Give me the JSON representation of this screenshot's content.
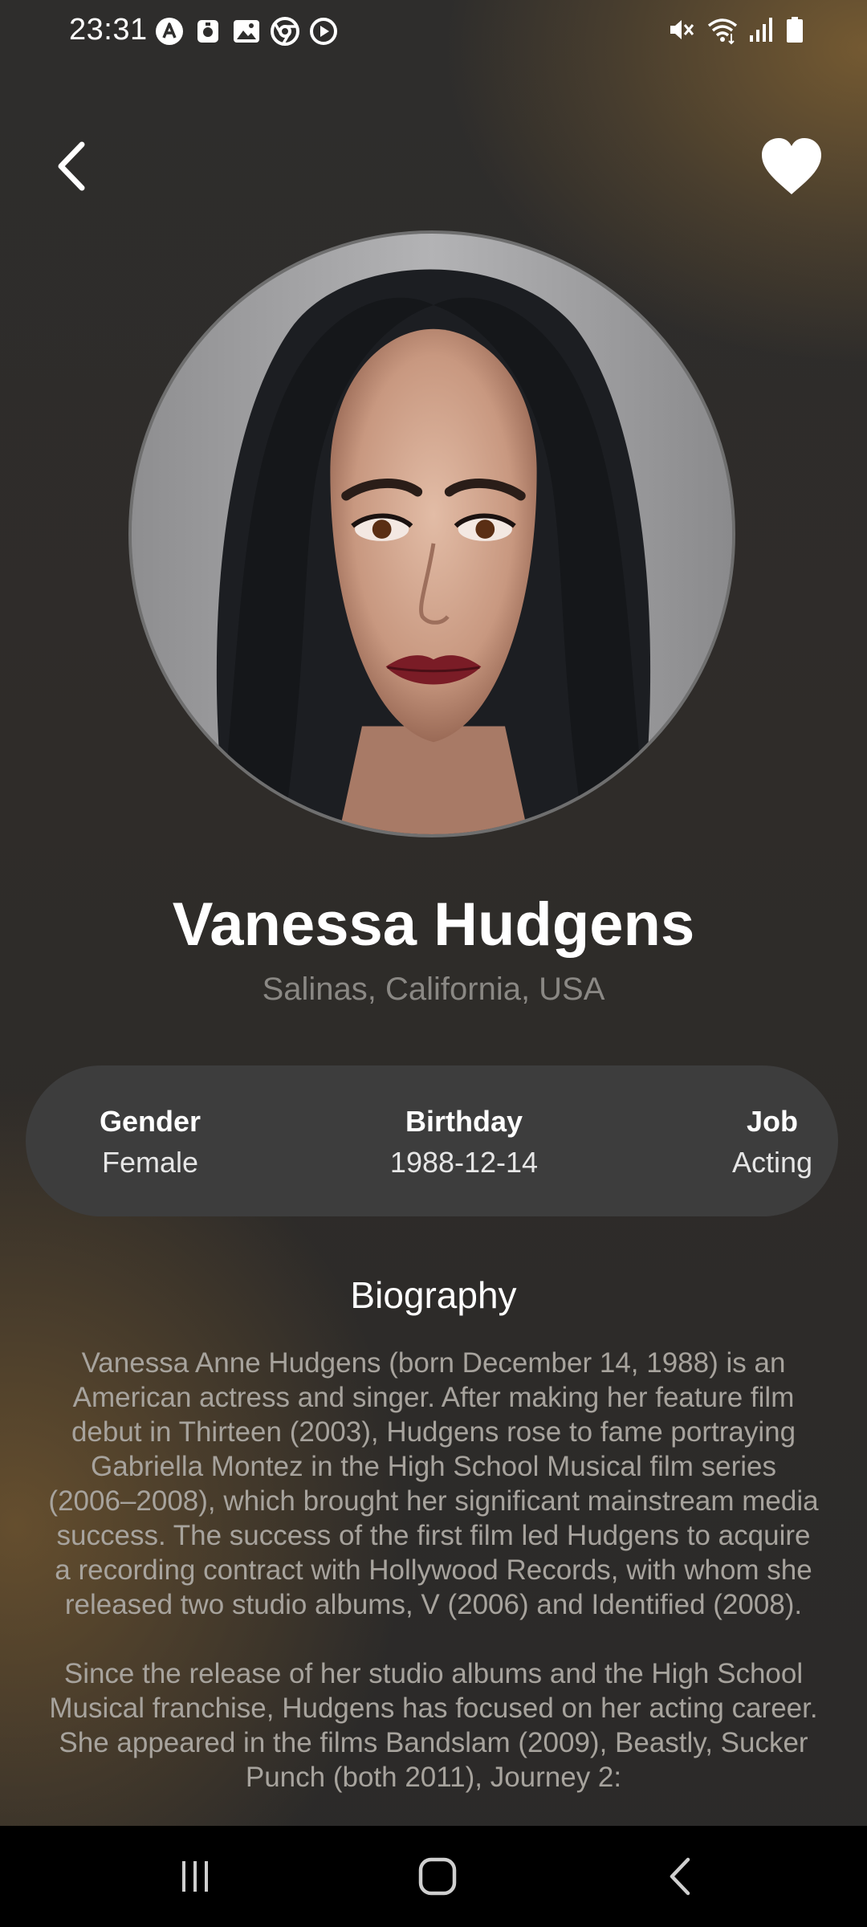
{
  "status_bar": {
    "time": "23:31",
    "left_icons": [
      "nav-app-icon",
      "vpn-icon",
      "gallery-icon",
      "chrome-icon",
      "media-icon"
    ],
    "right_icons": [
      "mute-icon",
      "wifi-icon",
      "signal-icon",
      "battery-icon"
    ]
  },
  "header": {
    "back_icon": "chevron-left-icon",
    "favorite_icon": "heart-icon"
  },
  "profile": {
    "name": "Vanessa Hudgens",
    "birthplace": "Salinas, California, USA"
  },
  "info": {
    "gender_label": "Gender",
    "gender_value": "Female",
    "birthday_label": "Birthday",
    "birthday_value": "1988-12-14",
    "job_label": "Job",
    "job_value": "Acting"
  },
  "biography": {
    "title": "Biography",
    "paragraph_1": "Vanessa Anne Hudgens (born December 14, 1988) is an American actress and singer. After making her feature film debut in Thirteen (2003), Hudgens rose to fame portraying Gabriella Montez in the High School Musical film series (2006–2008), which brought her significant mainstream media success. The success of the first film led Hudgens to acquire a recording contract with Hollywood Records, with whom she released two studio albums, V (2006) and Identified (2008).",
    "paragraph_2": "Since the release of her studio albums and the High School Musical franchise, Hudgens has focused on her acting career. She appeared in the films Bandslam (2009), Beastly, Sucker Punch (both 2011), Journey 2:"
  },
  "nav_bar": {
    "icons": [
      "recent-apps-icon",
      "home-icon",
      "back-icon"
    ]
  },
  "colors": {
    "background": "#2b2a29",
    "accent_brown": "#785c32",
    "card": "#3d3d3d",
    "muted_text": "#a7a39d",
    "place_text": "#8a8884"
  }
}
